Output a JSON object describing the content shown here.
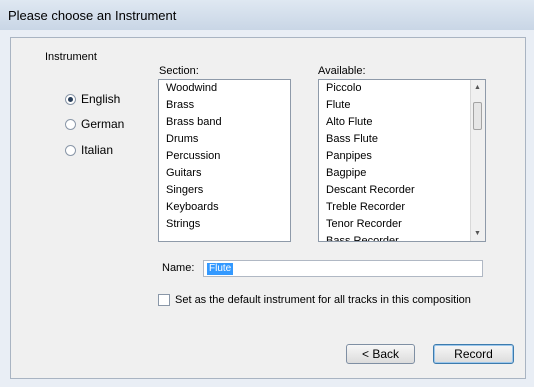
{
  "window": {
    "title": "Please choose an Instrument"
  },
  "instrument_group": {
    "label": "Instrument",
    "languages": [
      {
        "label": "English",
        "selected": true
      },
      {
        "label": "German",
        "selected": false
      },
      {
        "label": "Italian",
        "selected": false
      }
    ]
  },
  "section": {
    "label": "Section:",
    "items": [
      "Woodwind",
      "Brass",
      "Brass band",
      "Drums",
      "Percussion",
      "Guitars",
      "Singers",
      "Keyboards",
      "Strings"
    ]
  },
  "available": {
    "label": "Available:",
    "items": [
      "Piccolo",
      "Flute",
      "Alto Flute",
      "Bass Flute",
      "Panpipes",
      "Bagpipe",
      "Descant Recorder",
      "Treble Recorder",
      "Tenor Recorder",
      "Bass Recorder"
    ]
  },
  "name_field": {
    "label": "Name:",
    "value": "Flute"
  },
  "default_checkbox": {
    "label": "Set as the default instrument for all tracks in this composition",
    "checked": false
  },
  "buttons": {
    "back": "< Back",
    "record": "Record"
  }
}
